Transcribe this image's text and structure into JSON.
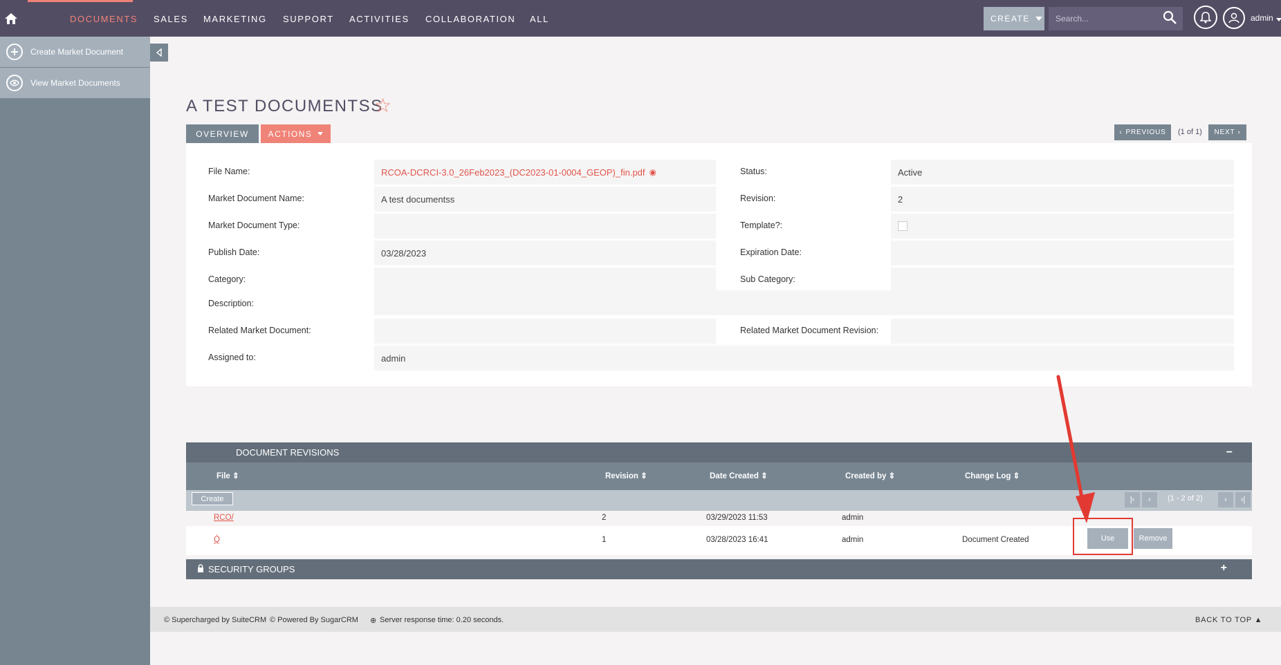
{
  "nav": {
    "items": [
      "DOCUMENTS",
      "SALES",
      "MARKETING",
      "SUPPORT",
      "ACTIVITIES",
      "COLLABORATION",
      "ALL"
    ],
    "create_label": "CREATE",
    "search_placeholder": "Search...",
    "user": "admin"
  },
  "sidebar": {
    "items": [
      {
        "label": "Create Market Document",
        "icon": "plus-icon"
      },
      {
        "label": "View Market Documents",
        "icon": "eye-icon"
      }
    ]
  },
  "record": {
    "title": "A TEST DOCUMENTSS",
    "tabs": {
      "overview": "OVERVIEW",
      "actions": "ACTIONS"
    },
    "pager": {
      "previous": "PREVIOUS",
      "position": "(1 of 1)",
      "next": "NEXT"
    },
    "fields": {
      "file_name": {
        "label": "File Name:",
        "value": "RCOA-DCRCI-3.0_26Feb2023_(DC2023-01-0004_GEOP)_fin.pdf"
      },
      "status": {
        "label": "Status:",
        "value": "Active"
      },
      "name": {
        "label": "Market Document Name:",
        "value": "A test documentss"
      },
      "revision": {
        "label": "Revision:",
        "value": "2"
      },
      "type": {
        "label": "Market Document Type:",
        "value": ""
      },
      "template": {
        "label": "Template?:",
        "value": false
      },
      "publish_date": {
        "label": "Publish Date:",
        "value": "03/28/2023"
      },
      "expiration_date": {
        "label": "Expiration Date:",
        "value": ""
      },
      "category": {
        "label": "Category:",
        "value": ""
      },
      "sub_category": {
        "label": "Sub Category:",
        "value": ""
      },
      "description": {
        "label": "Description:",
        "value": ""
      },
      "related_doc": {
        "label": "Related Market Document:",
        "value": ""
      },
      "related_rev": {
        "label": "Related Market Document Revision:",
        "value": ""
      },
      "assigned_to": {
        "label": "Assigned to:",
        "value": "admin"
      }
    }
  },
  "revisions": {
    "title": "DOCUMENT REVISIONS",
    "columns": {
      "file": "File",
      "revision": "Revision",
      "date_created": "Date Created",
      "created_by": "Created by",
      "change_log": "Change Log"
    },
    "create_label": "Create",
    "count": "(1 - 2 of 2)",
    "rows": [
      {
        "file": "RCO/",
        "revision": "2",
        "date": "03/29/2023 11:53",
        "by": "admin",
        "log": ""
      },
      {
        "file": "Q́",
        "revision": "1",
        "date": "03/28/2023 16:41",
        "by": "admin",
        "log": "Document Created"
      }
    ],
    "use_label": "Use",
    "remove_label": "Remove"
  },
  "security": {
    "title": "SECURITY GROUPS"
  },
  "footer": {
    "suitecrm": "© Supercharged by SuiteCRM",
    "sugarcrm": "© Powered By SugarCRM",
    "response": "Server response time: 0.20 seconds.",
    "back_to_top": "BACK TO TOP"
  },
  "colors": {
    "accent": "#f08377",
    "nav": "#534d64",
    "sidebar": "#778591",
    "annotation": "#e23a32"
  }
}
